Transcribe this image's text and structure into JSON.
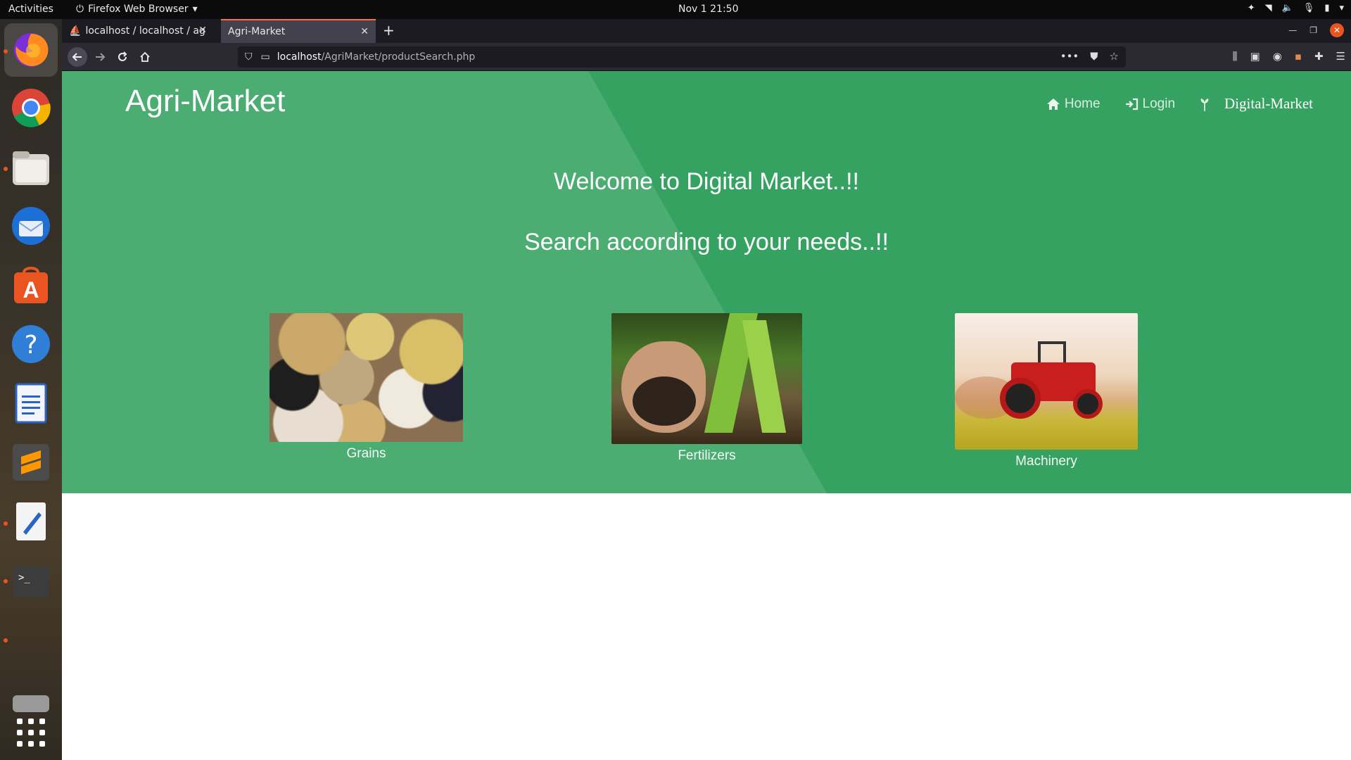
{
  "system": {
    "activities": "Activities",
    "app_menu": "Firefox Web Browser",
    "clock": "Nov 1  21:50"
  },
  "browser": {
    "tabs": [
      {
        "label": "localhost / localhost / ag"
      },
      {
        "label": "Agri-Market"
      }
    ],
    "url_host": "localhost",
    "url_path": "/AgriMarket/productSearch.php"
  },
  "site": {
    "brand": "Agri-Market",
    "nav": {
      "home": "Home",
      "login": "Login",
      "digital": "Digital-Market"
    },
    "welcome": "Welcome to Digital Market..!!",
    "search_prompt": "Search according to your needs..!!",
    "categories": [
      {
        "label": "Grains"
      },
      {
        "label": "Fertilizers"
      },
      {
        "label": "Machinery"
      }
    ]
  },
  "colors": {
    "hero_dark": "#35a262",
    "hero_light": "#4bad72",
    "tab_accent": "#ff6d3a"
  }
}
